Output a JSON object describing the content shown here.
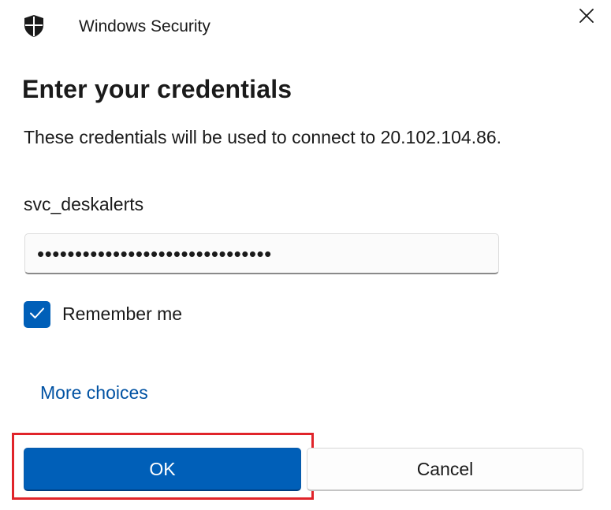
{
  "window": {
    "title": "Windows Security",
    "icon": "shield-icon",
    "close_icon": "close-icon"
  },
  "main": {
    "heading": "Enter your credentials",
    "description": "These credentials will be used to connect to 20.102.104.86.",
    "username": "svc_deskalerts",
    "password_value": "•••••••••••••••••••••••••••••••",
    "remember_me": {
      "label": "Remember me",
      "checked": true
    },
    "more_choices": "More choices"
  },
  "buttons": {
    "ok_label": "OK",
    "cancel_label": "Cancel"
  },
  "colors": {
    "accent": "#005fb8",
    "link": "#0052a3",
    "highlight": "#e0242a"
  }
}
